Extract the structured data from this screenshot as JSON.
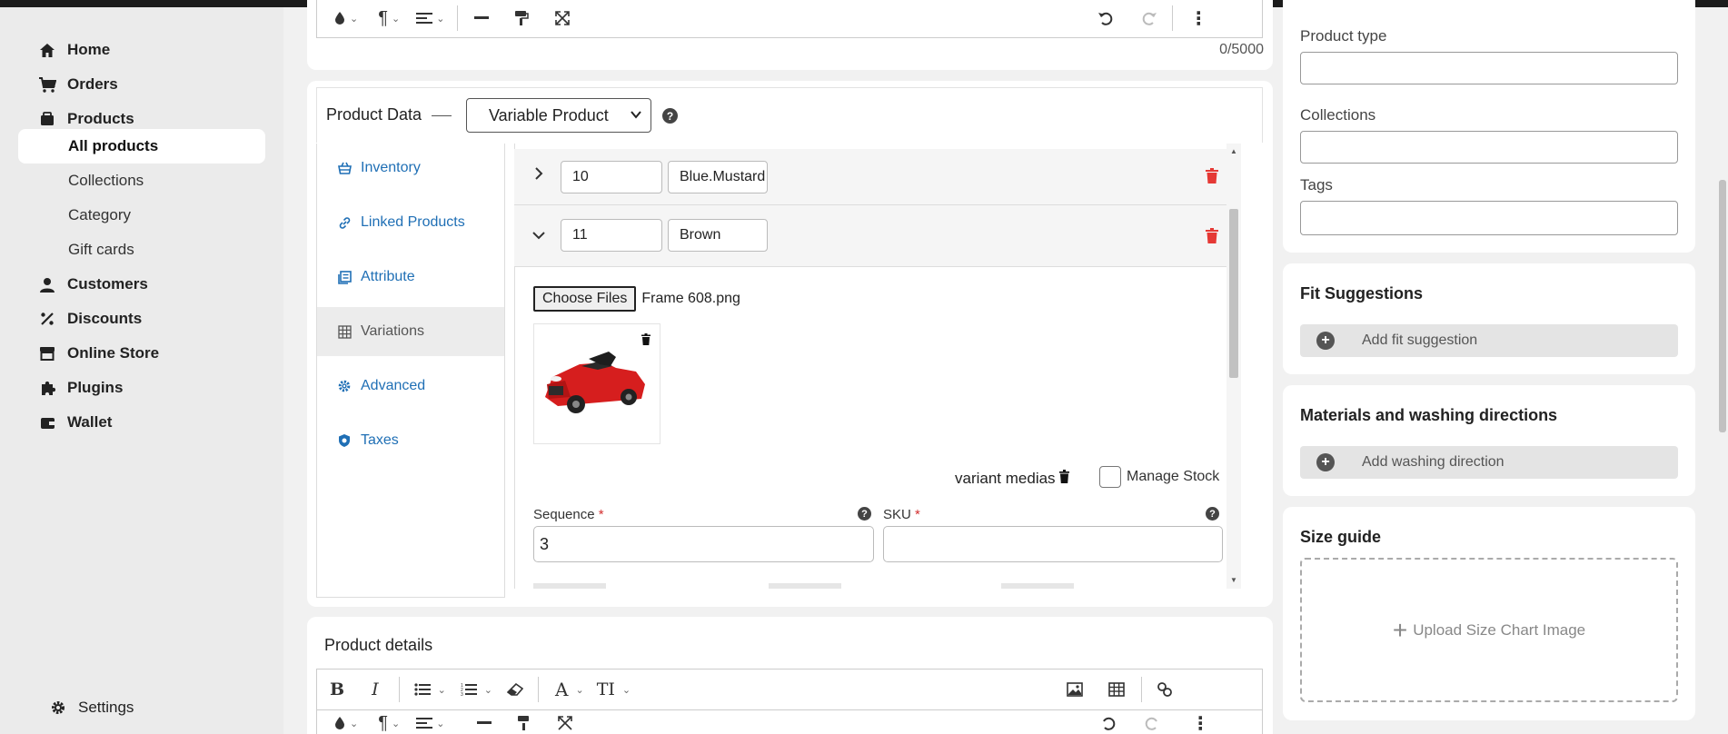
{
  "sidebar": {
    "items": [
      {
        "label": "Home",
        "icon": "home-icon"
      },
      {
        "label": "Orders",
        "icon": "cart-icon"
      },
      {
        "label": "Products",
        "icon": "tag-icon"
      },
      {
        "label": "Customers",
        "icon": "person-icon"
      },
      {
        "label": "Discounts",
        "icon": "percent-icon"
      },
      {
        "label": "Online Store",
        "icon": "store-icon"
      },
      {
        "label": "Plugins",
        "icon": "puzzle-icon"
      },
      {
        "label": "Wallet",
        "icon": "wallet-icon"
      }
    ],
    "product_subitems": [
      {
        "label": "All products",
        "active": true
      },
      {
        "label": "Collections"
      },
      {
        "label": "Category"
      },
      {
        "label": "Gift cards"
      }
    ],
    "settings_label": "Settings"
  },
  "description_editor": {
    "char_count": "0/5000"
  },
  "product_data": {
    "label": "Product Data",
    "type_value": "Variable Product",
    "tabs": [
      {
        "label": "Inventory",
        "icon": "basket-icon"
      },
      {
        "label": "Linked Products",
        "icon": "link-icon"
      },
      {
        "label": "Attribute",
        "icon": "list-icon"
      },
      {
        "label": "Variations",
        "icon": "grid-icon",
        "active": true
      },
      {
        "label": "Advanced",
        "icon": "gear-icon"
      },
      {
        "label": "Taxes",
        "icon": "shield-icon"
      }
    ]
  },
  "variations": {
    "rows": [
      {
        "number": "10",
        "name": "Blue.Mustard",
        "expanded": false
      },
      {
        "number": "11",
        "name": "Brown",
        "expanded": true
      }
    ],
    "choose_files_label": "Choose Files",
    "file_name": "Frame 608.png",
    "variant_medias_label": "variant medias",
    "manage_stock_label": "Manage Stock",
    "sequence_label": "Sequence",
    "sequence_value": "3",
    "sku_label": "SKU",
    "sku_value": "",
    "required_mark": "*"
  },
  "product_details": {
    "title": "Product details"
  },
  "right": {
    "product_type_label": "Product type",
    "collections_label": "Collections",
    "tags_label": "Tags",
    "fit_title": "Fit Suggestions",
    "fit_add_label": "Add fit suggestion",
    "materials_title": "Materials and washing directions",
    "materials_add_label": "Add washing direction",
    "size_title": "Size guide",
    "size_upload_label": "Upload Size Chart Image"
  },
  "colors": {
    "accent_blue": "#1f6fb5",
    "danger_red": "#e53935",
    "required_red": "#d32f2f"
  }
}
